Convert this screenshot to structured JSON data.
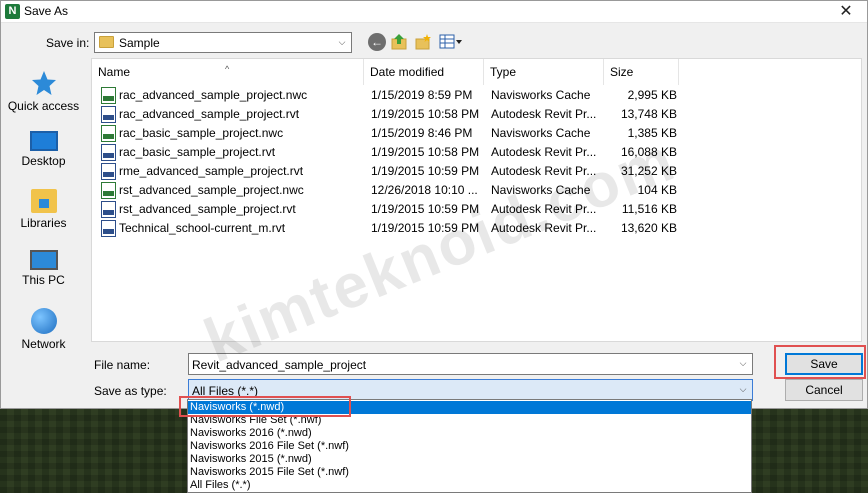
{
  "window": {
    "title": "Save As",
    "close_glyph": "✕"
  },
  "toolbar": {
    "save_in_label": "Save in:",
    "save_in_value": "Sample",
    "icons": [
      "back-icon",
      "up-folder-icon",
      "new-folder-icon",
      "view-menu-icon"
    ]
  },
  "places": [
    {
      "label": "Quick access",
      "icon": "star-icon"
    },
    {
      "label": "Desktop",
      "icon": "desktop-icon"
    },
    {
      "label": "Libraries",
      "icon": "libraries-icon"
    },
    {
      "label": "This PC",
      "icon": "this-pc-icon"
    },
    {
      "label": "Network",
      "icon": "network-icon"
    }
  ],
  "columns": {
    "name": "Name",
    "date": "Date modified",
    "type": "Type",
    "size": "Size"
  },
  "files": [
    {
      "name": "rac_advanced_sample_project.nwc",
      "date": "1/15/2019 8:59 PM",
      "type": "Navisworks Cache",
      "size": "2,995 KB",
      "kind": "nwc"
    },
    {
      "name": "rac_advanced_sample_project.rvt",
      "date": "1/19/2015 10:58 PM",
      "type": "Autodesk Revit Pr...",
      "size": "13,748 KB",
      "kind": "rvt"
    },
    {
      "name": "rac_basic_sample_project.nwc",
      "date": "1/15/2019 8:46 PM",
      "type": "Navisworks Cache",
      "size": "1,385 KB",
      "kind": "nwc"
    },
    {
      "name": "rac_basic_sample_project.rvt",
      "date": "1/19/2015 10:58 PM",
      "type": "Autodesk Revit Pr...",
      "size": "16,088 KB",
      "kind": "rvt"
    },
    {
      "name": "rme_advanced_sample_project.rvt",
      "date": "1/19/2015 10:59 PM",
      "type": "Autodesk Revit Pr...",
      "size": "31,252 KB",
      "kind": "rvt"
    },
    {
      "name": "rst_advanced_sample_project.nwc",
      "date": "12/26/2018 10:10 ...",
      "type": "Navisworks Cache",
      "size": "104 KB",
      "kind": "nwc"
    },
    {
      "name": "rst_advanced_sample_project.rvt",
      "date": "1/19/2015 10:59 PM",
      "type": "Autodesk Revit Pr...",
      "size": "11,516 KB",
      "kind": "rvt"
    },
    {
      "name": "Technical_school-current_m.rvt",
      "date": "1/19/2015 10:59 PM",
      "type": "Autodesk Revit Pr...",
      "size": "13,620 KB",
      "kind": "rvt"
    }
  ],
  "file_name": {
    "label": "File name:",
    "value": "Revit_advanced_sample_project"
  },
  "save_as_type": {
    "label": "Save as type:",
    "value": "All Files (*.*)",
    "options": [
      "Navisworks (*.nwd)",
      "Navisworks File Set (*.nwf)",
      "Navisworks 2016 (*.nwd)",
      "Navisworks 2016 File Set (*.nwf)",
      "Navisworks 2015 (*.nwd)",
      "Navisworks 2015 File Set (*.nwf)",
      "All Files (*.*)"
    ],
    "selected_index": 0
  },
  "buttons": {
    "save": "Save",
    "cancel": "Cancel"
  },
  "watermark": "kimteknoid.com",
  "colors": {
    "accent": "#0078d7",
    "highlight_box": "#e05050",
    "selection": "#0078d7"
  }
}
